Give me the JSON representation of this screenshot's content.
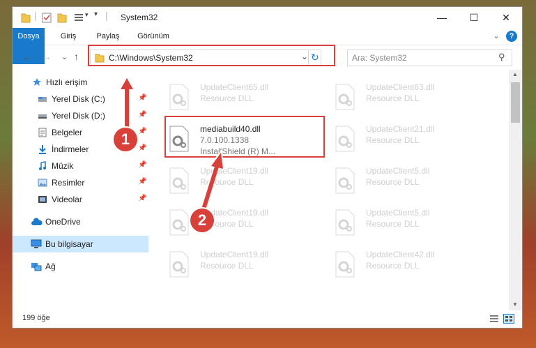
{
  "window": {
    "title": "System32",
    "minimize_glyph": "—",
    "maximize_glyph": "☐",
    "close_glyph": "✕"
  },
  "ribbon": {
    "tabs": [
      {
        "label": "Dosya"
      },
      {
        "label": "Giriş"
      },
      {
        "label": "Paylaş"
      },
      {
        "label": "Görünüm"
      }
    ],
    "expand_glyph": "⌄",
    "help_glyph": "?"
  },
  "address_bar": {
    "back_glyph": "←",
    "forward_glyph": "→",
    "recent_glyph": "⌄",
    "up_glyph": "↑",
    "path": "C:\\Windows\\System32",
    "refresh_glyph": "↻",
    "dropdown_glyph": "⌄"
  },
  "search": {
    "placeholder": "Ara: System32",
    "icon_glyph": "⚲"
  },
  "navigation": {
    "items": [
      {
        "label": "Hızlı erişim"
      },
      {
        "label": "Yerel Disk (C:)"
      },
      {
        "label": "Yerel Disk (D:)"
      },
      {
        "label": "Belgeler"
      },
      {
        "label": "İndirmeler"
      },
      {
        "label": "Müzik"
      },
      {
        "label": "Resimler"
      },
      {
        "label": "Videolar"
      },
      {
        "label": "OneDrive"
      },
      {
        "label": "Bu bilgisayar"
      },
      {
        "label": "Ağ"
      }
    ],
    "pin_glyph": "📌"
  },
  "files": {
    "highlighted": {
      "name": "mediabuild40.dll",
      "version": "7.0.100.1338",
      "description": "InstallShield (R) M..."
    },
    "others": [
      {
        "name": "UpdateClient65.dll",
        "description": "Resource DLL"
      },
      {
        "name": "UpdateClient63.dll",
        "description": "Resource DLL"
      },
      {
        "name": "UpdateClient21.dll",
        "description": "Resource DLL"
      },
      {
        "name": "UpdateClient19.dll",
        "description": "Resource DLL"
      },
      {
        "name": "UpdateClient5.dll",
        "description": "Resource DLL"
      },
      {
        "name": "UpdateClient19.dll",
        "description": "Resource DLL"
      },
      {
        "name": "UpdateClient5.dll",
        "description": "Resource DLL"
      },
      {
        "name": "UpdateClient19.dll",
        "description": "Resource DLL"
      },
      {
        "name": "UpdateClient42.dll",
        "description": "Resource DLL"
      }
    ]
  },
  "status_bar": {
    "item_count": "199 öğe"
  },
  "annotations": {
    "step1": "1",
    "step2": "2"
  },
  "colors": {
    "accent": "#1979ca",
    "highlight": "#d9403a",
    "selection": "#cce8ff"
  }
}
